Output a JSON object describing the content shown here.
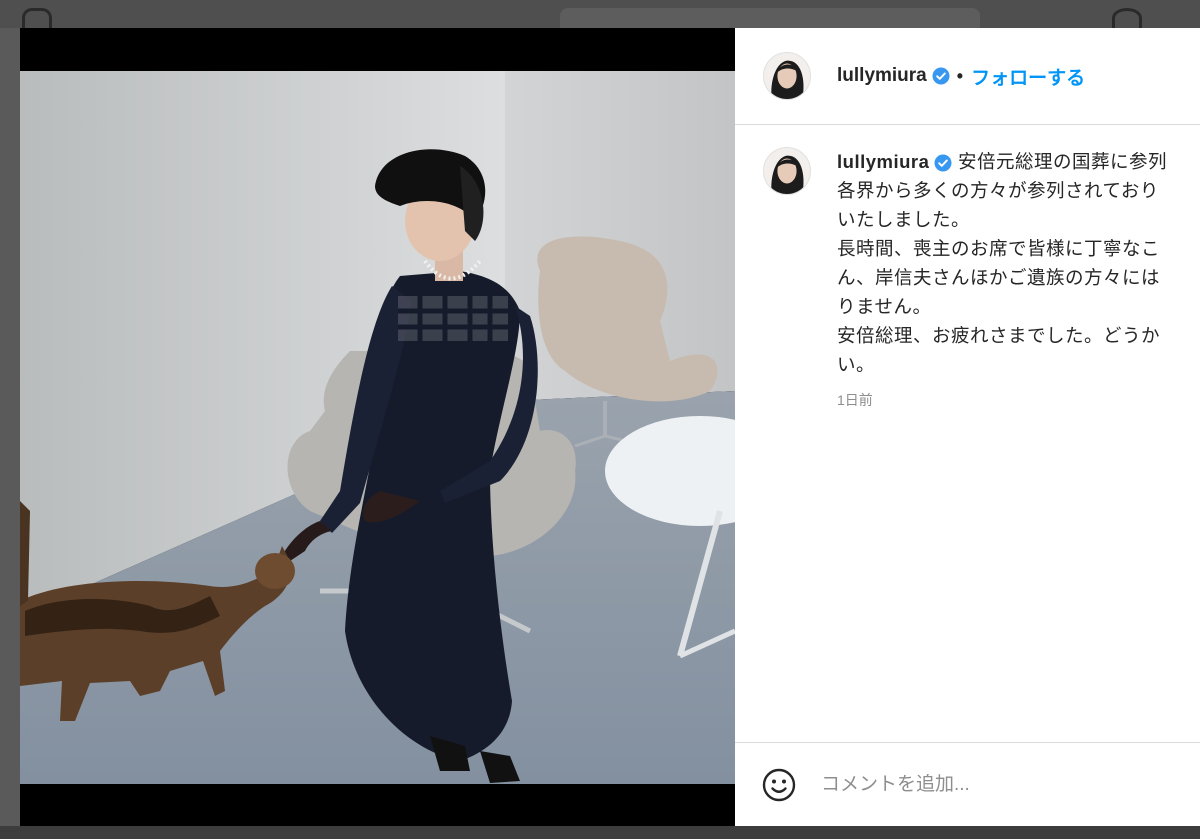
{
  "post": {
    "username": "lullymiura",
    "follow_label": "フォローする",
    "separator": "•",
    "caption_lines": [
      "安倍元総理の国葬に参列",
      "各界から多くの方々が参列されており",
      "いたしました。",
      "長時間、喪主のお席で皆様に丁寧なこ",
      "ん、岸信夫さんほかご遺族の方々には",
      "りません。",
      "安倍総理、お疲れさまでした。どうか",
      "い。"
    ],
    "timestamp": "1日前"
  },
  "composer": {
    "placeholder": "コメントを追加..."
  },
  "icons": {
    "verified": "verified-badge-icon",
    "emoji": "emoji-smiley-icon"
  },
  "colors": {
    "link_blue": "#0095f6",
    "verified_blue": "#3897f0",
    "text": "#262626",
    "muted": "#8e8e8e"
  }
}
